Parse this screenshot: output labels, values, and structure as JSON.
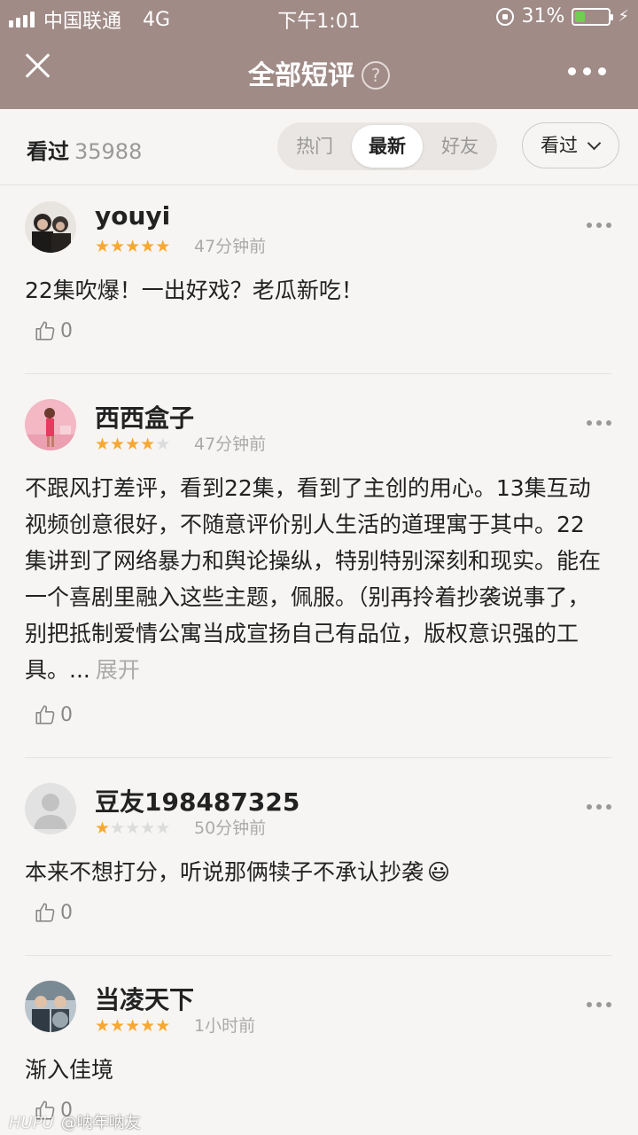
{
  "status_bar": {
    "carrier": "中国联通",
    "network": "4G",
    "time": "下午1:01",
    "battery_text": "31%",
    "battery_level": 0.31
  },
  "header": {
    "title": "全部短评",
    "help_glyph": "?"
  },
  "filter": {
    "seen_label": "看过",
    "seen_count": "35988",
    "tabs": [
      {
        "label": "热门",
        "active": false
      },
      {
        "label": "最新",
        "active": true
      },
      {
        "label": "好友",
        "active": false
      }
    ],
    "dropdown_label": "看过"
  },
  "reviews": [
    {
      "username": "youyi",
      "rating": 5,
      "time": "47分钟前",
      "text": "22集吹爆！一出好戏？老瓜新吃！",
      "likes": "0"
    },
    {
      "username": "西西盒子",
      "rating": 4,
      "time": "47分钟前",
      "text": "不跟风打差评，看到22集，看到了主创的用心。13集互动视频创意很好，不随意评价别人生活的道理寓于其中。22集讲到了网络暴力和舆论操纵，特别特别深刻和现实。能在一个喜剧里融入这些主题，佩服。（别再拎着抄袭说事了，别把抵制爱情公寓当成宣扬自己有品位，版权意识强的工具。...",
      "expand_label": "展开",
      "likes": "0"
    },
    {
      "username": "豆友198487325",
      "rating": 1,
      "time": "50分钟前",
      "text": "本来不想打分，听说那俩犊子不承认抄袭",
      "emoji": "😃",
      "likes": "0"
    },
    {
      "username": "当凌天下",
      "rating": 5,
      "time": "1小时前",
      "text": "渐入佳境",
      "likes": "0"
    }
  ],
  "watermark": {
    "logo": "HUPU",
    "text": "@呐年呐友"
  },
  "colors": {
    "header_bg": "#a08b87",
    "page_bg": "#f7f5f3",
    "star": "#f7a833",
    "battery_fill": "#6fd04d"
  },
  "icons": [
    "close-icon",
    "help-icon",
    "more-icon",
    "chevron-down-icon",
    "thumb-up-icon",
    "star-icon",
    "lock-rotation-icon",
    "battery-icon",
    "charging-bolt-icon",
    "signal-icon"
  ]
}
